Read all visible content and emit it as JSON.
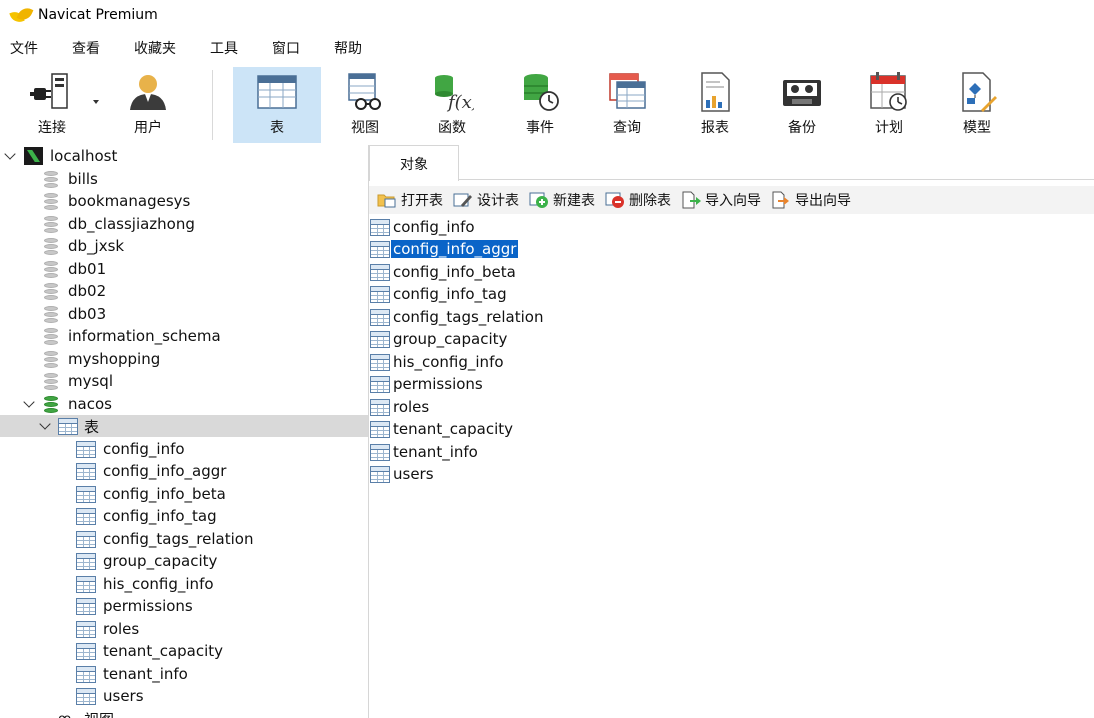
{
  "window": {
    "title": "Navicat Premium"
  },
  "menu": [
    "文件",
    "查看",
    "收藏夹",
    "工具",
    "窗口",
    "帮助"
  ],
  "toolbar": {
    "buttons": [
      {
        "label": "连接",
        "icon": "connection-icon"
      },
      {
        "label": "用户",
        "icon": "user-icon"
      },
      {
        "label": "表",
        "icon": "table-icon",
        "active": true
      },
      {
        "label": "视图",
        "icon": "view-icon"
      },
      {
        "label": "函数",
        "icon": "function-icon"
      },
      {
        "label": "事件",
        "icon": "event-icon"
      },
      {
        "label": "查询",
        "icon": "query-icon"
      },
      {
        "label": "报表",
        "icon": "report-icon"
      },
      {
        "label": "备份",
        "icon": "backup-icon"
      },
      {
        "label": "计划",
        "icon": "schedule-icon"
      },
      {
        "label": "模型",
        "icon": "model-icon"
      }
    ]
  },
  "nav": {
    "connection": "localhost",
    "databases": [
      "bills",
      "bookmanagesys",
      "db_classjiazhong",
      "db_jxsk",
      "db01",
      "db02",
      "db03",
      "information_schema",
      "myshopping",
      "mysql"
    ],
    "open_database": "nacos",
    "tables_node": "表",
    "tables": [
      "config_info",
      "config_info_aggr",
      "config_info_beta",
      "config_info_tag",
      "config_tags_relation",
      "group_capacity",
      "his_config_info",
      "permissions",
      "roles",
      "tenant_capacity",
      "tenant_info",
      "users"
    ],
    "views_node": "视图"
  },
  "objects": {
    "tab": "对象",
    "actions": [
      "打开表",
      "设计表",
      "新建表",
      "删除表",
      "导入向导",
      "导出向导"
    ],
    "selected": "config_info_aggr",
    "items": [
      "config_info",
      "config_info_aggr",
      "config_info_beta",
      "config_info_tag",
      "config_tags_relation",
      "group_capacity",
      "his_config_info",
      "permissions",
      "roles",
      "tenant_capacity",
      "tenant_info",
      "users"
    ]
  },
  "colors": {
    "selection": "#0a64c8",
    "toolbar_active": "#cce4f7",
    "db_open": "#41a643"
  }
}
